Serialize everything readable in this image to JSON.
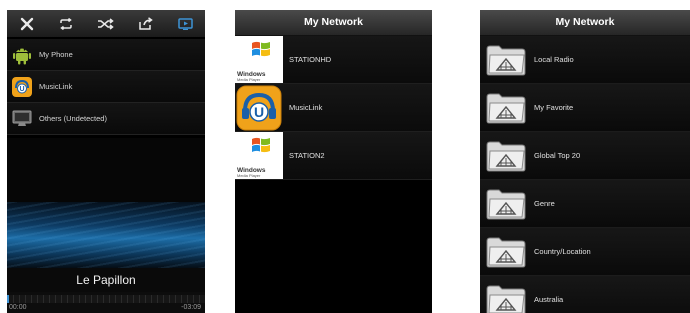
{
  "player": {
    "toolbar": {
      "icons": [
        "close-icon",
        "repeat-icon",
        "shuffle-icon",
        "share-icon",
        "screen-icon"
      ]
    },
    "devices": [
      {
        "label": "My Phone",
        "icon": "android-icon"
      },
      {
        "label": "MusicLink",
        "icon": "musiclink-logo-icon"
      },
      {
        "label": "Others (Undetected)",
        "icon": "monitor-icon"
      }
    ],
    "track_title": "Le Papillon",
    "elapsed": "00:00",
    "remaining": "-03:09",
    "progress": 0.01
  },
  "network": {
    "title": "My Network",
    "servers": [
      {
        "label": "STATIONHD",
        "icon": "windows-media-player-icon"
      },
      {
        "label": "MusicLink",
        "icon": "musiclink-logo-icon"
      },
      {
        "label": "STATION2",
        "icon": "windows-media-player-icon"
      }
    ],
    "wmp_text": "Windows",
    "wmp_sub": "Media Player"
  },
  "radio": {
    "title": "My Network",
    "categories": [
      {
        "label": "Local Radio",
        "icon": "folder-icon"
      },
      {
        "label": "My Favorite",
        "icon": "folder-icon"
      },
      {
        "label": "Global Top 20",
        "icon": "folder-icon"
      },
      {
        "label": "Genre",
        "icon": "folder-icon"
      },
      {
        "label": "Country/Location",
        "icon": "folder-icon"
      },
      {
        "label": "Australia",
        "icon": "folder-icon"
      }
    ]
  },
  "colors": {
    "accent_blue": "#3d94d6",
    "android_green": "#9fbf3b",
    "musiclink_orange": "#f0a21a"
  }
}
